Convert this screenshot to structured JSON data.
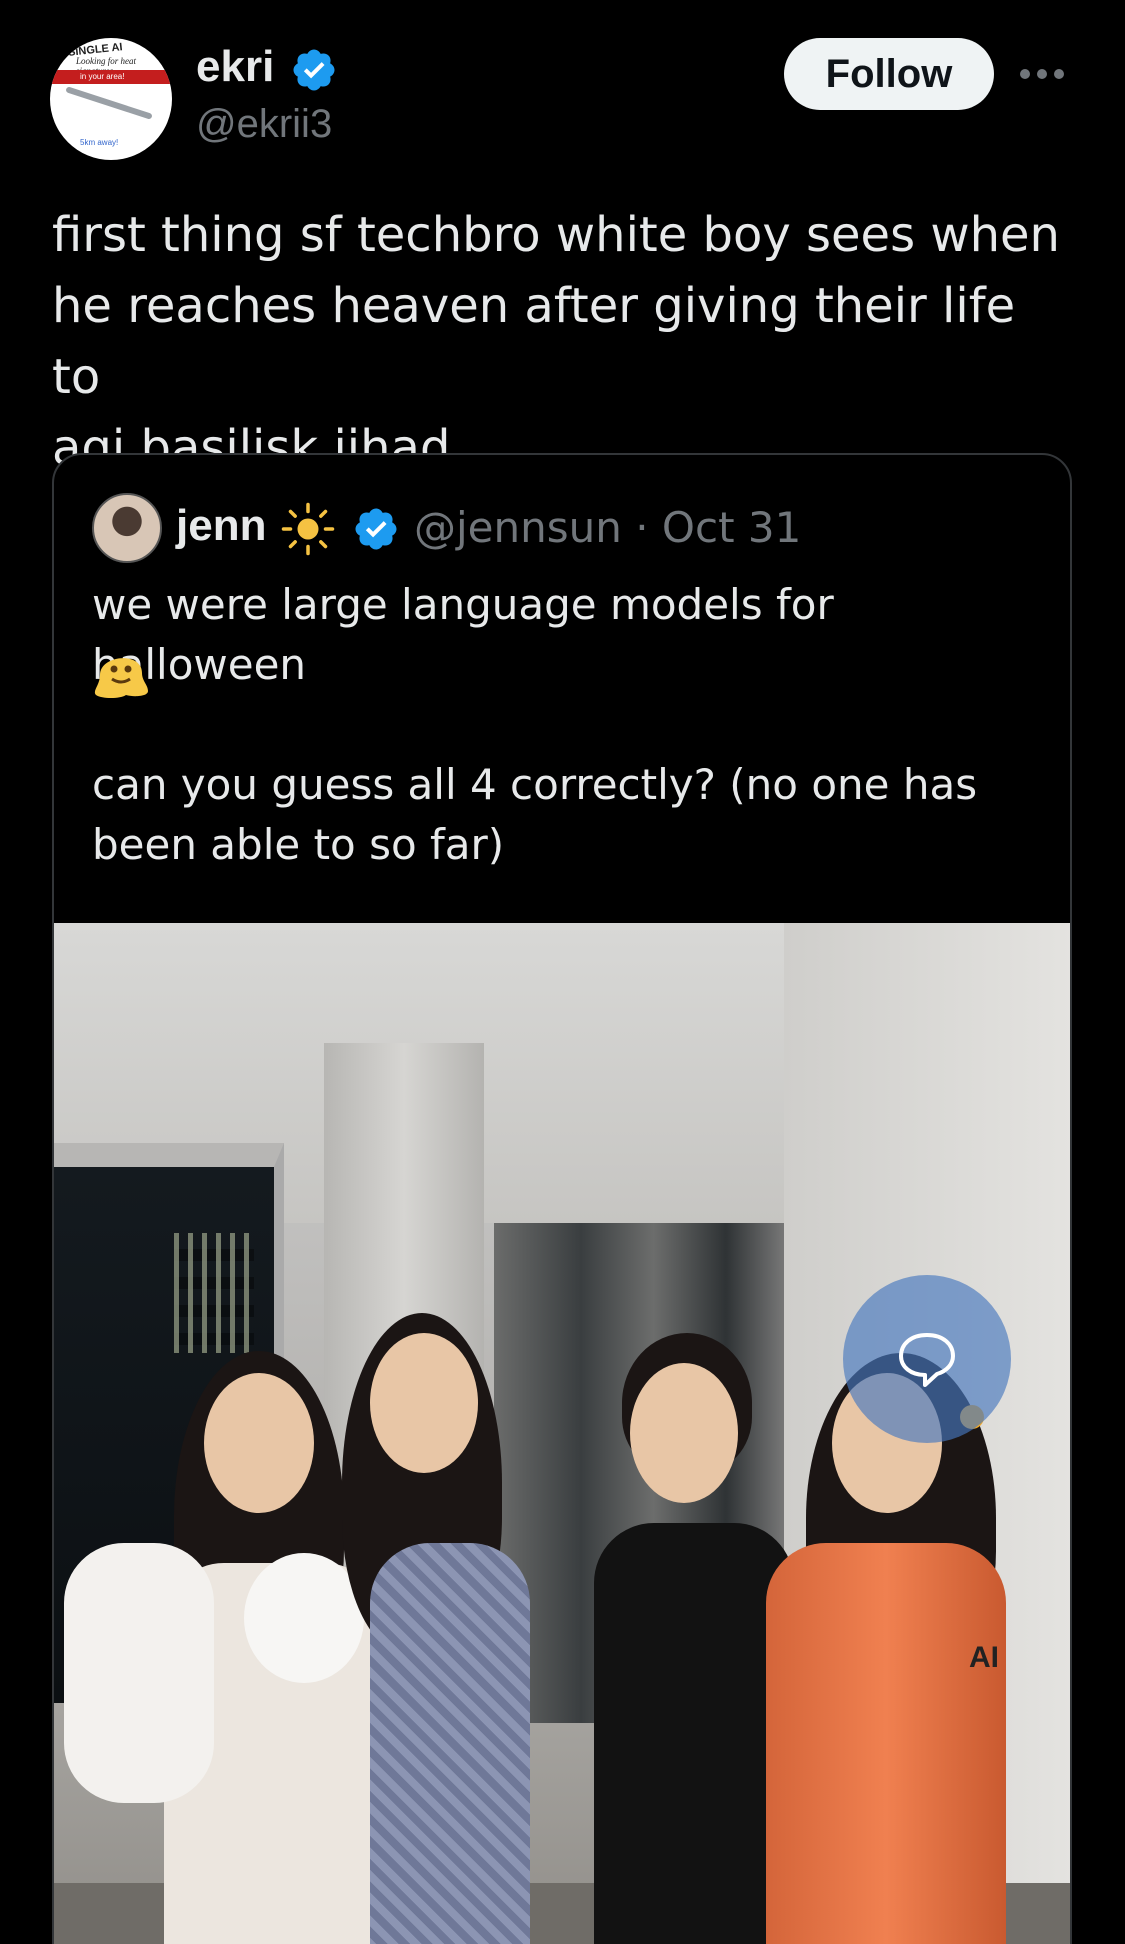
{
  "post": {
    "author_name": "ekri",
    "author_handle": "@ekrii3",
    "follow_label": "Follow",
    "text": "first thing sf techbro white boy sees when\nhe reaches heaven after giving their life to\nagi basilisk jihad",
    "avatar_text": {
      "line1": "SINGLE AI",
      "line2": "Looking for heat signatures",
      "line3": "in your area!",
      "line4": "5km away!"
    }
  },
  "quote": {
    "author_name": "jenn",
    "meta": "@jennsun · Oct 31",
    "text_line1": "we were large language models for halloween",
    "text_line2": "can you guess all 4 correctly? (no one has\nbeen able to so far)",
    "photo_arm_text": "AI"
  },
  "icons": {
    "verified": "verified-badge-icon",
    "sun": "sun-emoji-icon",
    "melting": "melting-face-emoji-icon",
    "more": "more-icon",
    "chat": "chat-bubble-icon"
  },
  "colors": {
    "verified": "#1d9bf0",
    "background": "#000000",
    "text": "#e7e9ea",
    "secondary": "#71767b"
  }
}
